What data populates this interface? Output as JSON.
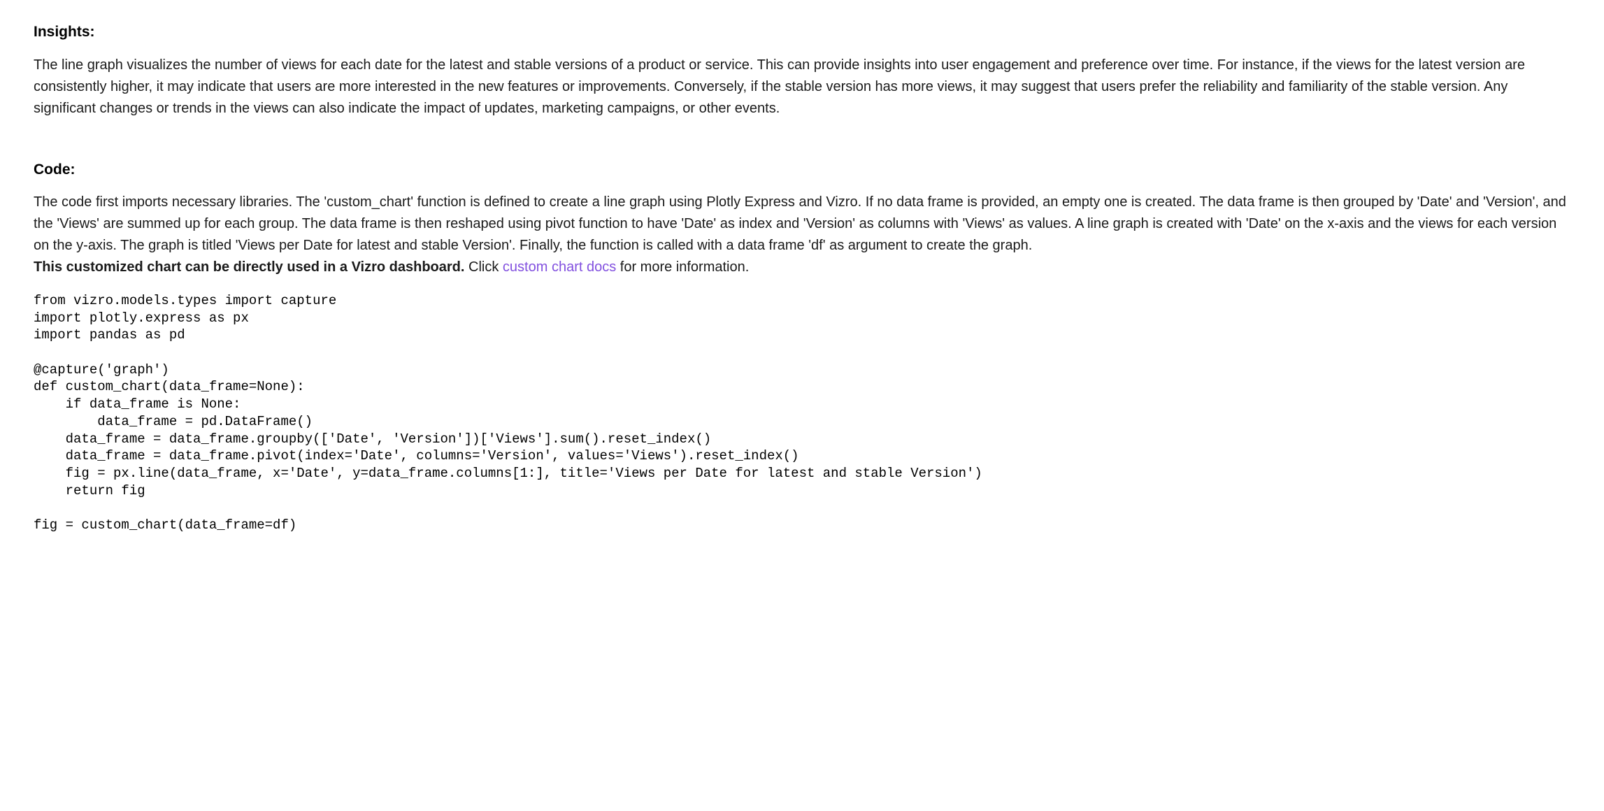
{
  "insights": {
    "heading": "Insights:",
    "body": "The line graph visualizes the number of views for each date for the latest and stable versions of a product or service. This can provide insights into user engagement and preference over time. For instance, if the views for the latest version are consistently higher, it may indicate that users are more interested in the new features or improvements. Conversely, if the stable version has more views, it may suggest that users prefer the reliability and familiarity of the stable version. Any significant changes or trends in the views can also indicate the impact of updates, marketing campaigns, or other events."
  },
  "code": {
    "heading": "Code:",
    "explanation": "The code first imports necessary libraries. The 'custom_chart' function is defined to create a line graph using Plotly Express and Vizro. If no data frame is provided, an empty one is created. The data frame is then grouped by 'Date' and 'Version', and the 'Views' are summed up for each group. The data frame is then reshaped using pivot function to have 'Date' as index and 'Version' as columns with 'Views' as values. A line graph is created with 'Date' on the x-axis and the views for each version on the y-axis. The graph is titled 'Views per Date for latest and stable Version'. Finally, the function is called with a data frame 'df' as argument to create the graph.",
    "bold_prefix": "This customized chart can be directly used in a Vizro dashboard.",
    "click_text": " Click ",
    "link_text": "custom chart docs",
    "suffix_text": " for more information.",
    "source": "from vizro.models.types import capture\nimport plotly.express as px\nimport pandas as pd\n\n@capture('graph')\ndef custom_chart(data_frame=None):\n    if data_frame is None:\n        data_frame = pd.DataFrame()\n    data_frame = data_frame.groupby(['Date', 'Version'])['Views'].sum().reset_index()\n    data_frame = data_frame.pivot(index='Date', columns='Version', values='Views').reset_index()\n    fig = px.line(data_frame, x='Date', y=data_frame.columns[1:], title='Views per Date for latest and stable Version')\n    return fig\n\nfig = custom_chart(data_frame=df)"
  }
}
